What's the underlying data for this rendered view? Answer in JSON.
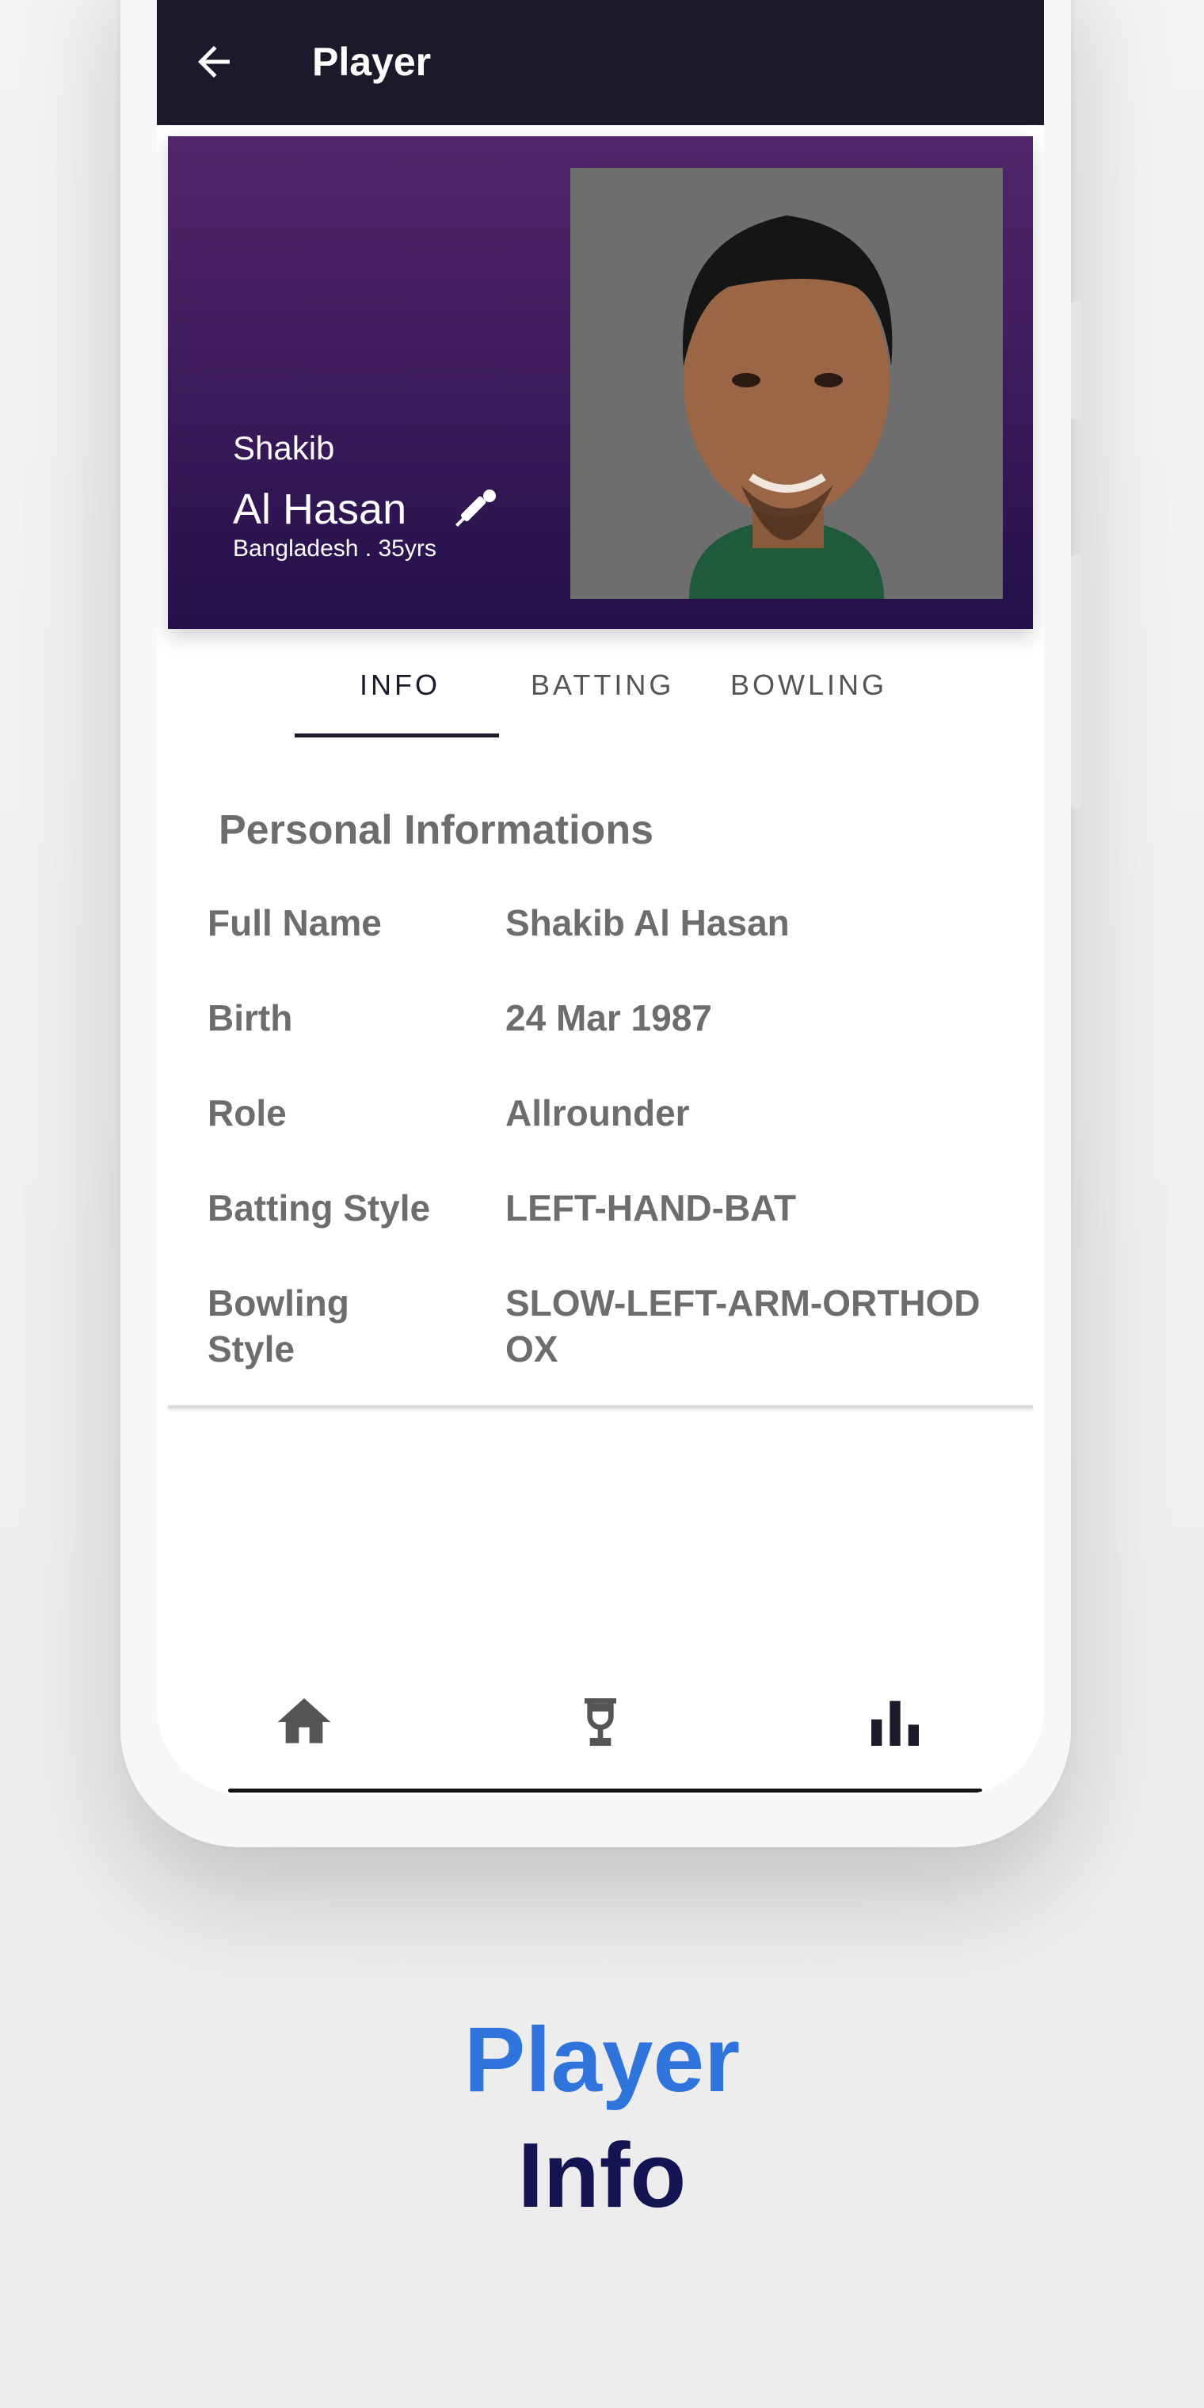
{
  "appbar": {
    "title": "Player"
  },
  "player": {
    "first_name": "Shakib",
    "last_name": "Al Hasan",
    "meta": "Bangladesh . 35yrs"
  },
  "tabs": [
    {
      "label": "INFO"
    },
    {
      "label": "BATTING"
    },
    {
      "label": "BOWLING"
    }
  ],
  "info": {
    "section_title": "Personal Informations",
    "rows": [
      {
        "key": "Full Name",
        "value": "Shakib Al Hasan"
      },
      {
        "key": "Birth",
        "value": "24 Mar 1987"
      },
      {
        "key": "Role",
        "value": "Allrounder"
      },
      {
        "key": "Batting Style",
        "value": "LEFT-HAND-BAT"
      },
      {
        "key": "Bowling Style",
        "value": "SLOW-LEFT-ARM-ORTHODOX"
      }
    ]
  },
  "bottom_nav": [
    "home-icon",
    "trophy-icon",
    "bar-chart-icon"
  ],
  "caption": {
    "line1": "Player",
    "line2": "Info"
  },
  "colors": {
    "appbar": "#1c1a2a",
    "hero_top": "#52266a",
    "hero_bottom": "#24104a",
    "caption_blue": "#2f74dd",
    "caption_navy": "#141452"
  }
}
